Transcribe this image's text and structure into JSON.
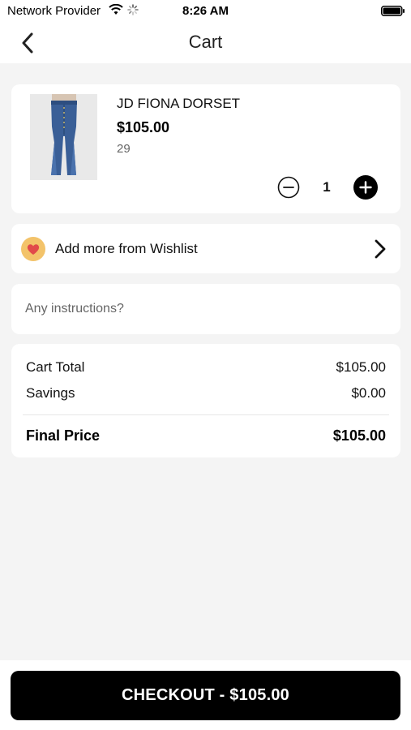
{
  "status_bar": {
    "carrier": "Network Provider",
    "time": "8:26 AM"
  },
  "nav": {
    "title": "Cart",
    "back_icon": "chevron-left-icon"
  },
  "product": {
    "name": "JD FIONA DORSET",
    "price": "$105.00",
    "size": "29",
    "quantity": "1",
    "image": "jeans-photo"
  },
  "wishlist": {
    "label": "Add more from Wishlist",
    "icon": "heart-icon"
  },
  "instructions": {
    "placeholder": "Any instructions?",
    "value": ""
  },
  "summary": {
    "cart_total_label": "Cart Total",
    "cart_total_value": "$105.00",
    "savings_label": "Savings",
    "savings_value": "$0.00",
    "final_label": "Final Price",
    "final_value": "$105.00"
  },
  "checkout": {
    "label": "CHECKOUT - $105.00"
  },
  "colors": {
    "background": "#f4f4f4",
    "button": "#000000",
    "heart_badge": "#f3c36a",
    "heart": "#e14a4a"
  }
}
